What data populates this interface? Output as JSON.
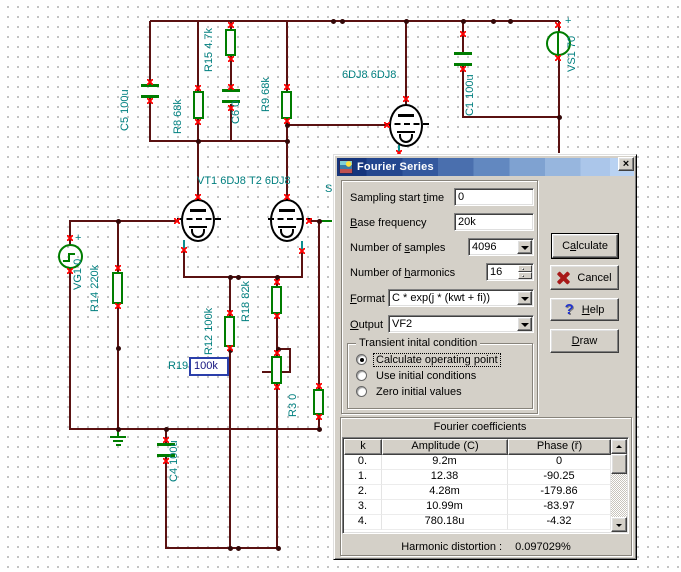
{
  "colors": {
    "wire": "#5a1111",
    "component": "#007d00",
    "label": "#007f7f",
    "terminal_mark": "#ff0000",
    "dialog_face": "#d4d0c8",
    "title_left": "#15357d",
    "title_right": "#b9d2f2",
    "edit_border": "#2b3faa"
  },
  "schematic": {
    "labels": {
      "c5": "C5 100u",
      "r8": "R8 68k",
      "r15": "R15 4.7k",
      "c6": "C6 0",
      "r9": "R9 68k",
      "c1": "C1 100u",
      "vs1": "VS1 70",
      "vs1_plus": "+",
      "tube_top": "6DJ8 6DJ8",
      "vt1": "VT1 6DJ8",
      "t2": "T2 6DJ8",
      "sw": "S",
      "vg1": "VG1 0",
      "vg1_plus": "+",
      "r14": "R14 220k",
      "r12": "R12 100k",
      "r18": "R18 82k",
      "r19_name": "R19",
      "r19_value": "100k",
      "r3": "R3 0",
      "c4": "C4 100u"
    }
  },
  "dialog": {
    "title": "Fourier Series",
    "close_glyph": "×",
    "fields": {
      "sampling": {
        "pre": "Sampling start ",
        "u": "t",
        "post": "ime",
        "value": "0"
      },
      "base": {
        "pre": "",
        "u": "B",
        "post": "ase frequency",
        "value": "20k"
      },
      "samples": {
        "pre": "Number of ",
        "u": "s",
        "post": "amples",
        "value": "4096"
      },
      "harmonics": {
        "pre": "Number of ",
        "u": "h",
        "post": "armonics",
        "value": "16"
      },
      "format": {
        "pre": "",
        "u": "F",
        "post": "ormat",
        "value": "C * exp(j * (kwt + fi))"
      },
      "output": {
        "pre": "",
        "u": "O",
        "post": "utput",
        "value": "VF2"
      }
    },
    "group": {
      "legend": "Transient inital condition",
      "options": [
        "Calculate operating point",
        "Use initial conditions",
        "Zero initial values"
      ],
      "selected": 0
    },
    "buttons": {
      "calculate": {
        "pre": "C",
        "u": "a",
        "post": "lculate"
      },
      "cancel": {
        "label": "Cancel"
      },
      "help": {
        "pre": "",
        "u": "H",
        "post": "elp",
        "icon": "?"
      },
      "draw": {
        "pre": "",
        "u": "D",
        "post": "raw"
      }
    },
    "coeffs": {
      "title": "Fourier coefficients",
      "columns": [
        "k",
        "Amplitude (C)",
        "Phase (ř)"
      ],
      "rows": [
        [
          "0.",
          "9.2m",
          "0"
        ],
        [
          "1.",
          "12.38",
          "-90.25"
        ],
        [
          "2.",
          "4.28m",
          "-179.86"
        ],
        [
          "3.",
          "10.99m",
          "-83.97"
        ],
        [
          "4.",
          "780.18u",
          "-4.32"
        ]
      ],
      "footer_label": "Harmonic distortion :",
      "footer_value": "0.097029%"
    }
  }
}
